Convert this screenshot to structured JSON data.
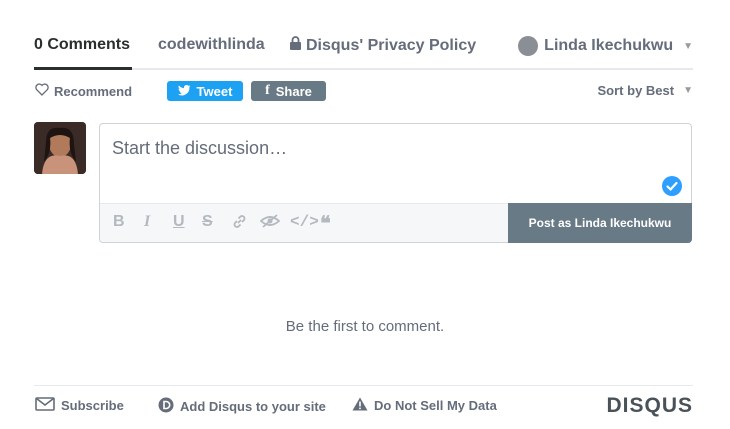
{
  "nav": {
    "comments_tab": "0 Comments",
    "community_tab": "codewithlinda",
    "privacy": "Disqus' Privacy Policy",
    "user": "Linda Ikechukwu"
  },
  "actions": {
    "recommend": "Recommend",
    "tweet": "Tweet",
    "share": "Share",
    "sort": "Sort by Best"
  },
  "composer": {
    "placeholder": "Start the discussion…",
    "post_button": "Post as Linda Ikechukwu",
    "tools": [
      "bold-icon",
      "italic-icon",
      "underline-icon",
      "strikethrough-icon",
      "link-icon",
      "spoiler-icon",
      "code-icon",
      "quote-icon"
    ]
  },
  "empty_state": "Be the first to comment.",
  "footer": {
    "subscribe": "Subscribe",
    "add_disqus": "Add Disqus to your site",
    "do_not_sell": "Do Not Sell My Data",
    "brand": "DISQUS"
  },
  "colors": {
    "tweet": "#1da1f2",
    "share": "#687a86",
    "check": "#2e9fff"
  }
}
